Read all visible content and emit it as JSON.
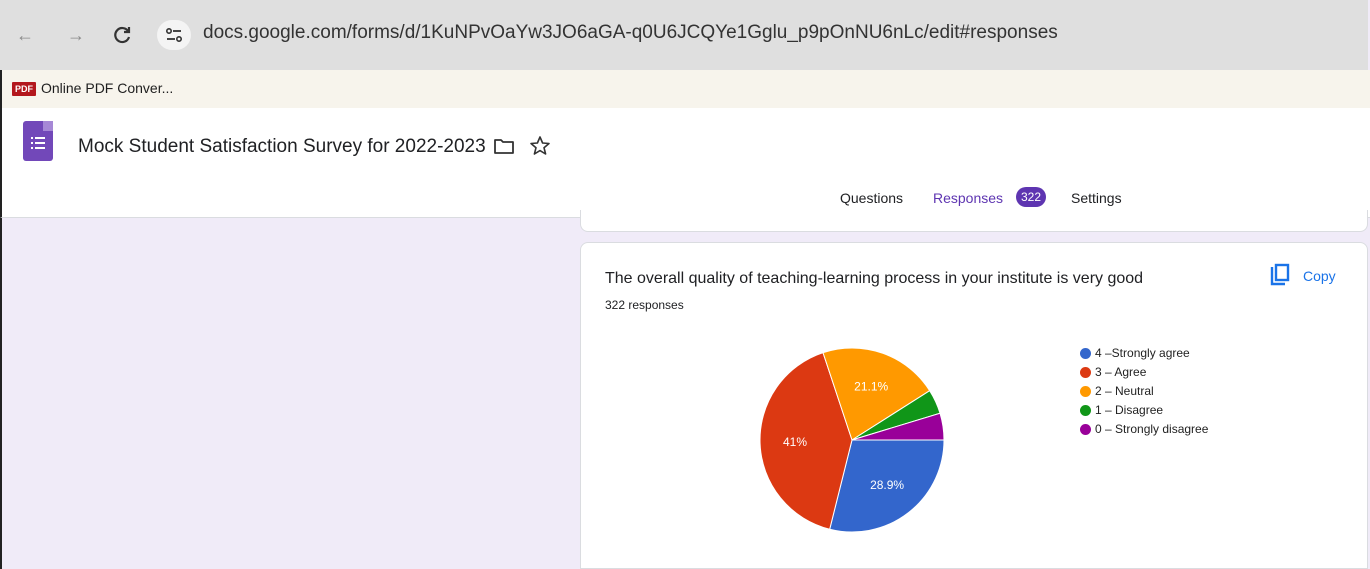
{
  "browser": {
    "url": "docs.google.com/forms/d/1KuNPvOaYw3JO6aGA-q0U6JCQYe1Gglu_p9pOnNU6nLc/edit#responses",
    "bookmark": {
      "badge": "PDF",
      "label": "Online PDF Conver..."
    }
  },
  "header": {
    "title": "Mock Student Satisfaction Survey for 2022-2023",
    "tabs": [
      {
        "label": "Questions"
      },
      {
        "label": "Responses",
        "badge": "322",
        "active": true
      },
      {
        "label": "Settings"
      }
    ]
  },
  "card": {
    "question": "The overall quality of teaching-learning process in your institute is very good",
    "response_count": "322 responses",
    "copy_label": "Copy"
  },
  "colors": {
    "accent": "#5e35b1",
    "link": "#1a73e8"
  },
  "chart_data": {
    "type": "pie",
    "slices": [
      {
        "label": "4 –Strongly agree",
        "percent": 28.9,
        "display": "28.9%",
        "color": "#3366cc"
      },
      {
        "label": "3 – Agree",
        "percent": 41,
        "display": "41%",
        "color": "#dc3912"
      },
      {
        "label": "2 – Neutral",
        "percent": 21.1,
        "display": "21.1%",
        "color": "#ff9900"
      },
      {
        "label": "1 – Disagree",
        "percent": 4.3,
        "display": "",
        "color": "#109618"
      },
      {
        "label": "0 – Strongly disagree",
        "percent": 4.7,
        "display": "",
        "color": "#990099"
      }
    ],
    "legend_position": "right"
  }
}
